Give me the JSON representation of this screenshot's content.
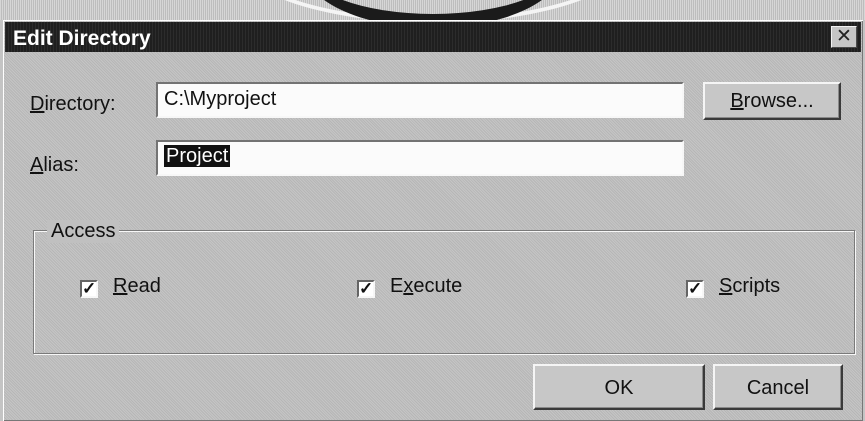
{
  "dialog": {
    "title": "Edit Directory",
    "close_label": "✕"
  },
  "fields": {
    "directory_label": "Directory:",
    "directory_value": "C:\\Myproject",
    "browse_label": "Browse...",
    "alias_label": "Alias:",
    "alias_value": "Project"
  },
  "access": {
    "group_label": "Access",
    "options": [
      {
        "label": "Read",
        "checked": true
      },
      {
        "label": "Execute",
        "checked": true
      },
      {
        "label": "Scripts",
        "checked": true
      }
    ]
  },
  "buttons": {
    "ok_label": "OK",
    "cancel_label": "Cancel"
  }
}
